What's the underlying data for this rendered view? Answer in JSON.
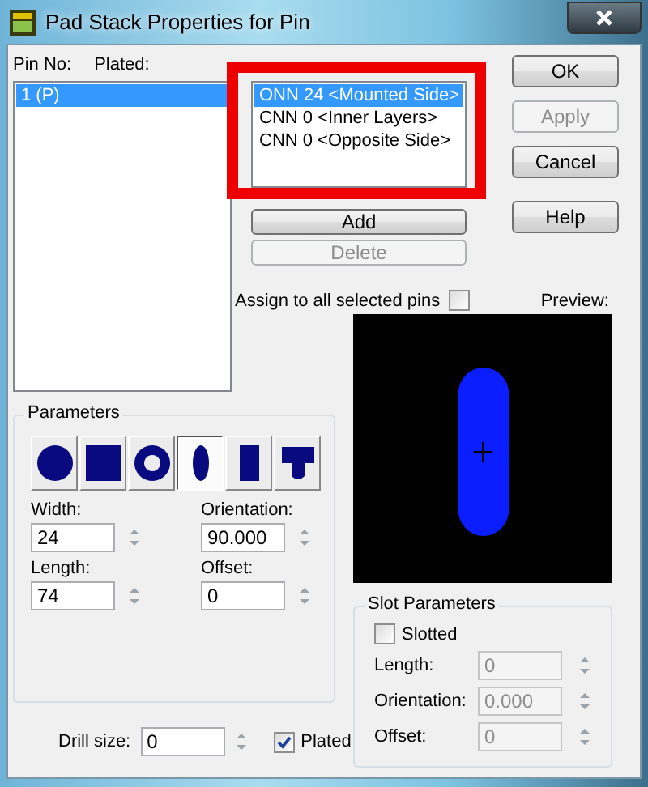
{
  "window": {
    "title": "Pad Stack Properties for Pin"
  },
  "pins": {
    "headers": [
      "Pin No:",
      "Plated:"
    ],
    "items": [
      {
        "label": "1 (P)",
        "selected": true
      }
    ]
  },
  "slot_sizes": {
    "highlight_frame": true,
    "items": [
      {
        "label": "ONN 24 <Mounted Side>",
        "selected": true
      },
      {
        "label": "CNN 0 <Inner Layers>",
        "selected": false
      },
      {
        "label": "CNN 0 <Opposite Side>",
        "selected": false
      }
    ]
  },
  "list_buttons": [
    {
      "label": "Add",
      "disabled": false
    },
    {
      "label": "Delete",
      "disabled": true
    }
  ],
  "dialog_buttons": [
    {
      "label": "OK",
      "disabled": false
    },
    {
      "label": "Apply",
      "disabled": true
    },
    {
      "label": "Cancel",
      "disabled": false
    },
    {
      "label": "Help",
      "disabled": false
    }
  ],
  "assign": {
    "label": "Assign to all selected pins",
    "checked": false
  },
  "preview": {
    "label": "Preview:"
  },
  "parameters": {
    "title": "Parameters",
    "shapes": [
      {
        "kind": "round",
        "selected": false
      },
      {
        "kind": "square",
        "selected": false
      },
      {
        "kind": "annular",
        "selected": false
      },
      {
        "kind": "oval",
        "selected": true
      },
      {
        "kind": "rectangle",
        "selected": false
      },
      {
        "kind": "custom",
        "selected": false
      }
    ],
    "fields": [
      {
        "label": "Width:",
        "value": "24"
      },
      {
        "label": "Orientation:",
        "value": "90.000"
      },
      {
        "label": "Length:",
        "value": "74"
      },
      {
        "label": "Offset:",
        "value": "0"
      }
    ]
  },
  "drill": {
    "label": "Drill size:",
    "value": "0",
    "plated": {
      "label": "Plated",
      "checked": true
    }
  },
  "slot_parameters": {
    "title": "Slot Parameters",
    "slotted": {
      "label": "Slotted",
      "checked": false
    },
    "fields": [
      {
        "label": "Length:",
        "value": "0",
        "disabled": true
      },
      {
        "label": "Orientation:",
        "value": "0.000",
        "disabled": true
      },
      {
        "label": "Offset:",
        "value": "0",
        "disabled": true
      }
    ]
  }
}
